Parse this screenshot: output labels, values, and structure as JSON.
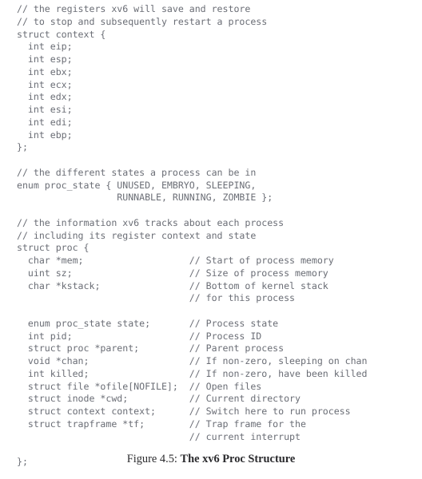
{
  "figure": {
    "caption_label": "Figure 4.5: ",
    "caption_title": "The xv6 Proc Structure",
    "text_color": "#6b6e76",
    "caption_color": "#2b2b2e",
    "background_color": "#ffffff"
  },
  "code": {
    "language": "c",
    "lines": [
      "// the registers xv6 will save and restore",
      "// to stop and subsequently restart a process",
      "struct context {",
      "  int eip;",
      "  int esp;",
      "  int ebx;",
      "  int ecx;",
      "  int edx;",
      "  int esi;",
      "  int edi;",
      "  int ebp;",
      "};",
      "",
      "// the different states a process can be in",
      "enum proc_state { UNUSED, EMBRYO, SLEEPING,",
      "                  RUNNABLE, RUNNING, ZOMBIE };",
      "",
      "// the information xv6 tracks about each process",
      "// including its register context and state",
      "struct proc {",
      "  char *mem;                   // Start of process memory",
      "  uint sz;                     // Size of process memory",
      "  char *kstack;                // Bottom of kernel stack",
      "                               // for this process",
      "",
      "  enum proc_state state;       // Process state",
      "  int pid;                     // Process ID",
      "  struct proc *parent;         // Parent process",
      "  void *chan;                  // If non-zero, sleeping on chan",
      "  int killed;                  // If non-zero, have been killed",
      "  struct file *ofile[NOFILE];  // Open files",
      "  struct inode *cwd;           // Current directory",
      "  struct context context;      // Switch here to run process",
      "  struct trapframe *tf;        // Trap frame for the",
      "                               // current interrupt",
      "",
      "};"
    ]
  }
}
